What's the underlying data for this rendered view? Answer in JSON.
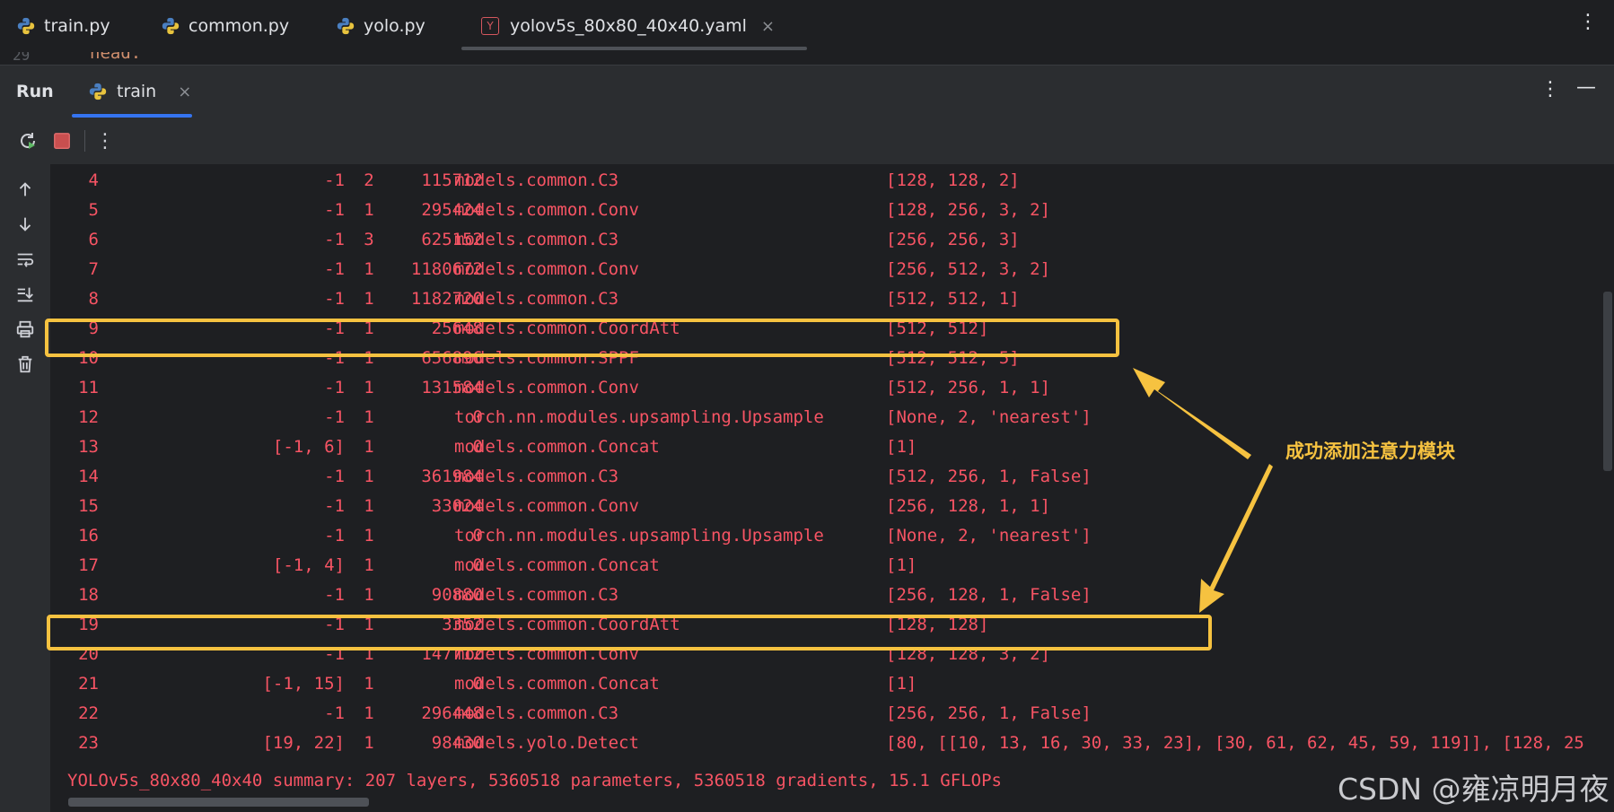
{
  "tabs": [
    {
      "label": "train.py",
      "icon": "python-icon"
    },
    {
      "label": "common.py",
      "icon": "python-icon"
    },
    {
      "label": "yolo.py",
      "icon": "python-icon"
    },
    {
      "label": "yolov5s_80x80_40x40.yaml",
      "icon": "yaml-icon",
      "active": true,
      "close": "×"
    }
  ],
  "editor_peek": {
    "line_number": "29",
    "code": "head:"
  },
  "run_panel": {
    "title": "Run",
    "tab_label": "train",
    "tab_close": "×"
  },
  "console": {
    "rows": [
      {
        "idx": "4",
        "from": "-1",
        "n": "2",
        "params": "115712",
        "module": "models.common.C3",
        "args": "[128, 128, 2]"
      },
      {
        "idx": "5",
        "from": "-1",
        "n": "1",
        "params": "295424",
        "module": "models.common.Conv",
        "args": "[128, 256, 3, 2]"
      },
      {
        "idx": "6",
        "from": "-1",
        "n": "3",
        "params": "625152",
        "module": "models.common.C3",
        "args": "[256, 256, 3]"
      },
      {
        "idx": "7",
        "from": "-1",
        "n": "1",
        "params": "1180672",
        "module": "models.common.Conv",
        "args": "[256, 512, 3, 2]"
      },
      {
        "idx": "8",
        "from": "-1",
        "n": "1",
        "params": "1182720",
        "module": "models.common.C3",
        "args": "[512, 512, 1]"
      },
      {
        "idx": "9",
        "from": "-1",
        "n": "1",
        "params": "25648",
        "module": "models.common.CoordAtt",
        "args": "[512, 512]"
      },
      {
        "idx": "10",
        "from": "-1",
        "n": "1",
        "params": "656896",
        "module": "models.common.SPPF",
        "args": "[512, 512, 5]"
      },
      {
        "idx": "11",
        "from": "-1",
        "n": "1",
        "params": "131584",
        "module": "models.common.Conv",
        "args": "[512, 256, 1, 1]"
      },
      {
        "idx": "12",
        "from": "-1",
        "n": "1",
        "params": "0",
        "module": "torch.nn.modules.upsampling.Upsample",
        "args": "[None, 2, 'nearest']"
      },
      {
        "idx": "13",
        "from": "[-1, 6]",
        "n": "1",
        "params": "0",
        "module": "models.common.Concat",
        "args": "[1]"
      },
      {
        "idx": "14",
        "from": "-1",
        "n": "1",
        "params": "361984",
        "module": "models.common.C3",
        "args": "[512, 256, 1, False]"
      },
      {
        "idx": "15",
        "from": "-1",
        "n": "1",
        "params": "33024",
        "module": "models.common.Conv",
        "args": "[256, 128, 1, 1]"
      },
      {
        "idx": "16",
        "from": "-1",
        "n": "1",
        "params": "0",
        "module": "torch.nn.modules.upsampling.Upsample",
        "args": "[None, 2, 'nearest']"
      },
      {
        "idx": "17",
        "from": "[-1, 4]",
        "n": "1",
        "params": "0",
        "module": "models.common.Concat",
        "args": "[1]"
      },
      {
        "idx": "18",
        "from": "-1",
        "n": "1",
        "params": "90880",
        "module": "models.common.C3",
        "args": "[256, 128, 1, False]"
      },
      {
        "idx": "19",
        "from": "-1",
        "n": "1",
        "params": "3352",
        "module": "models.common.CoordAtt",
        "args": "[128, 128]"
      },
      {
        "idx": "20",
        "from": "-1",
        "n": "1",
        "params": "147712",
        "module": "models.common.Conv",
        "args": "[128, 128, 3, 2]"
      },
      {
        "idx": "21",
        "from": "[-1, 15]",
        "n": "1",
        "params": "0",
        "module": "models.common.Concat",
        "args": "[1]"
      },
      {
        "idx": "22",
        "from": "-1",
        "n": "1",
        "params": "296448",
        "module": "models.common.C3",
        "args": "[256, 256, 1, False]"
      },
      {
        "idx": "23",
        "from": "[19, 22]",
        "n": "1",
        "params": "98430",
        "module": "models.yolo.Detect",
        "args": "[80, [[10, 13, 16, 30, 33, 23], [30, 61, 62, 45, 59, 119]], [128, 25"
      }
    ],
    "summary": "YOLOv5s_80x80_40x40 summary: 207 layers, 5360518 parameters, 5360518 gradients, 15.1 GFLOPs"
  },
  "annotation": {
    "text": "成功添加注意力模块",
    "color": "#f6c240",
    "highlighted_rows": [
      "9",
      "19"
    ]
  },
  "watermark": "CSDN @雍凉明月夜",
  "colors": {
    "console_text": "#f75464",
    "background": "#1e1f22",
    "panel": "#2b2d30",
    "accent": "#3574f0",
    "highlight": "#f6c240"
  }
}
